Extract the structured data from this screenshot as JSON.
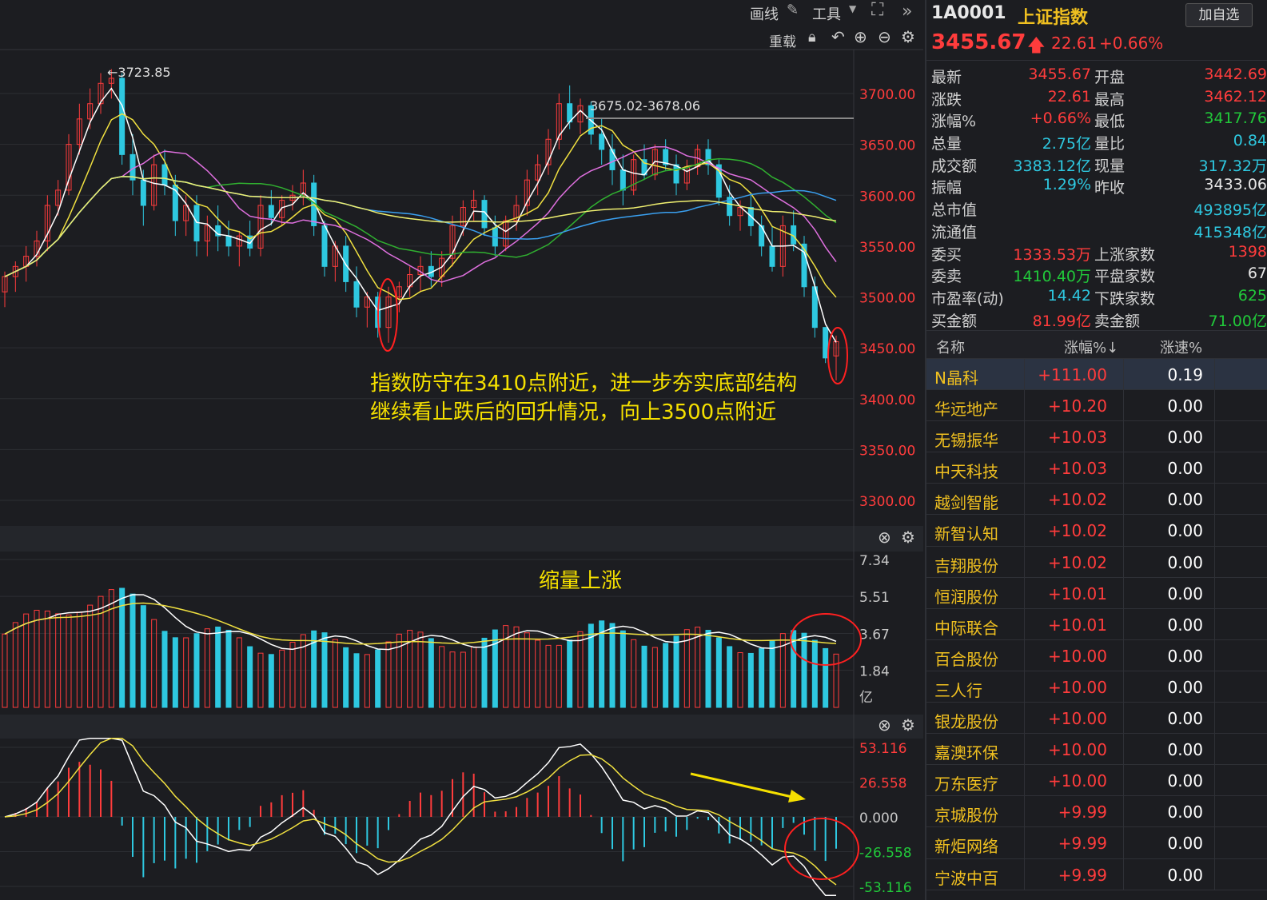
{
  "toolbar": {
    "draw": "画线",
    "tools": "工具",
    "restore": "重载"
  },
  "header": {
    "code": "1A0001",
    "name": "上证指数",
    "add_button": "加自选",
    "price": "3455.67",
    "change": "22.61",
    "change_pct": "+0.66%"
  },
  "quote": [
    {
      "l1": "最新",
      "v1": "3455.67",
      "c1": "#ff3c3c",
      "l2": "开盘",
      "v2": "3442.69",
      "c2": "#ff3c3c"
    },
    {
      "l1": "涨跌",
      "v1": "22.61",
      "c1": "#ff3c3c",
      "l2": "最高",
      "v2": "3462.12",
      "c2": "#ff3c3c"
    },
    {
      "l1": "涨幅%",
      "v1": "+0.66%",
      "c1": "#ff3c3c",
      "l2": "最低",
      "v2": "3417.76",
      "c2": "#21c93a"
    },
    {
      "l1": "总量",
      "v1": "2.75亿",
      "c1": "#2ec8e0",
      "l2": "量比",
      "v2": "0.84",
      "c2": "#2ec8e0"
    },
    {
      "l1": "成交额",
      "v1": "3383.12亿",
      "c1": "#2ec8e0",
      "l2": "现量",
      "v2": "317.32万",
      "c2": "#2ec8e0"
    },
    {
      "l1": "振幅",
      "v1": "1.29%",
      "c1": "#2ec8e0",
      "l2": "昨收",
      "v2": "3433.06",
      "c2": "#e8e8e8"
    },
    {
      "l1": "总市值",
      "v1": "",
      "c1": "#2ec8e0",
      "l2": "",
      "v2": "493895亿",
      "c2": "#2ec8e0"
    },
    {
      "l1": "流通值",
      "v1": "",
      "c1": "#2ec8e0",
      "l2": "",
      "v2": "415348亿",
      "c2": "#2ec8e0"
    },
    {
      "l1": "委买",
      "v1": "1333.53万",
      "c1": "#ff3c3c",
      "l2": "上涨家数",
      "v2": "1398",
      "c2": "#ff3c3c"
    },
    {
      "l1": "委卖",
      "v1": "1410.40万",
      "c1": "#21c93a",
      "l2": "平盘家数",
      "v2": "67",
      "c2": "#e8e8e8"
    },
    {
      "l1": "市盈率(动)",
      "v1": "14.42",
      "c1": "#2ec8e0",
      "l2": "下跌家数",
      "v2": "625",
      "c2": "#21c93a"
    },
    {
      "l1": "买金额",
      "v1": "81.99亿",
      "c1": "#ff3c3c",
      "l2": "卖金额",
      "v2": "71.00亿",
      "c2": "#21c93a"
    }
  ],
  "table": {
    "headers": [
      "名称",
      "涨幅%↓",
      "涨速%"
    ],
    "rows": [
      {
        "name": "N晶科",
        "pct": "+111.00",
        "speed": "0.19",
        "selected": true
      },
      {
        "name": "华远地产",
        "pct": "+10.20",
        "speed": "0.00"
      },
      {
        "name": "无锡振华",
        "pct": "+10.03",
        "speed": "0.00"
      },
      {
        "name": "中天科技",
        "pct": "+10.03",
        "speed": "0.00"
      },
      {
        "name": "越剑智能",
        "pct": "+10.02",
        "speed": "0.00"
      },
      {
        "name": "新智认知",
        "pct": "+10.02",
        "speed": "0.00"
      },
      {
        "name": "吉翔股份",
        "pct": "+10.02",
        "speed": "0.00"
      },
      {
        "name": "恒润股份",
        "pct": "+10.01",
        "speed": "0.00"
      },
      {
        "name": "中际联合",
        "pct": "+10.01",
        "speed": "0.00"
      },
      {
        "name": "百合股份",
        "pct": "+10.00",
        "speed": "0.00"
      },
      {
        "name": "三人行",
        "pct": "+10.00",
        "speed": "0.00"
      },
      {
        "name": "银龙股份",
        "pct": "+10.00",
        "speed": "0.00"
      },
      {
        "name": "嘉澳环保",
        "pct": "+10.00",
        "speed": "0.00"
      },
      {
        "name": "万东医疗",
        "pct": "+10.00",
        "speed": "0.00"
      },
      {
        "name": "京城股份",
        "pct": "+9.99",
        "speed": "0.00"
      },
      {
        "name": "新炬网络",
        "pct": "+9.99",
        "speed": "0.00"
      },
      {
        "name": "宁波中百",
        "pct": "+9.99",
        "speed": "0.00"
      }
    ]
  },
  "annotations": {
    "high": "←3723.85",
    "range": "3675.02-3678.06",
    "note_line1": "指数防守在3410点附近，进一步夯实底部结构",
    "note_line2": "继续看止跌后的回升情况，向上3500点附近",
    "volume_note": "缩量上涨"
  },
  "colors": {
    "up": "#ff3c3c",
    "down": "#2ec8e0",
    "note": "#f5e000"
  },
  "chart_data": [
    {
      "type": "candlestick",
      "title": "",
      "yticks": [
        "3700.00",
        "3650.00",
        "3600.00",
        "3550.00",
        "3500.00",
        "3450.00",
        "3400.00",
        "3350.00",
        "3300.00"
      ],
      "ylim": [
        3285,
        3740
      ],
      "candles": [
        [
          3505,
          3525,
          3490,
          3520
        ],
        [
          3520,
          3535,
          3505,
          3530
        ],
        [
          3530,
          3550,
          3515,
          3540
        ],
        [
          3540,
          3565,
          3530,
          3555
        ],
        [
          3555,
          3600,
          3545,
          3590
        ],
        [
          3590,
          3615,
          3580,
          3605
        ],
        [
          3605,
          3660,
          3600,
          3650
        ],
        [
          3650,
          3690,
          3640,
          3675
        ],
        [
          3675,
          3705,
          3665,
          3690
        ],
        [
          3690,
          3720,
          3680,
          3710
        ],
        [
          3710,
          3724,
          3695,
          3715
        ],
        [
          3715,
          3720,
          3630,
          3640
        ],
        [
          3640,
          3660,
          3600,
          3615
        ],
        [
          3615,
          3625,
          3570,
          3590
        ],
        [
          3590,
          3640,
          3585,
          3630
        ],
        [
          3630,
          3645,
          3600,
          3610
        ],
        [
          3610,
          3620,
          3560,
          3575
        ],
        [
          3575,
          3600,
          3560,
          3590
        ],
        [
          3590,
          3600,
          3540,
          3555
        ],
        [
          3555,
          3580,
          3540,
          3570
        ],
        [
          3570,
          3590,
          3545,
          3560
        ],
        [
          3560,
          3575,
          3540,
          3550
        ],
        [
          3550,
          3565,
          3530,
          3560
        ],
        [
          3560,
          3575,
          3540,
          3548
        ],
        [
          3548,
          3600,
          3540,
          3590
        ],
        [
          3590,
          3605,
          3570,
          3578
        ],
        [
          3578,
          3600,
          3570,
          3595
        ],
        [
          3595,
          3610,
          3585,
          3600
        ],
        [
          3600,
          3625,
          3590,
          3612
        ],
        [
          3612,
          3620,
          3560,
          3570
        ],
        [
          3570,
          3575,
          3520,
          3530
        ],
        [
          3530,
          3555,
          3515,
          3550
        ],
        [
          3550,
          3560,
          3505,
          3515
        ],
        [
          3515,
          3530,
          3480,
          3490
        ],
        [
          3490,
          3505,
          3470,
          3500
        ],
        [
          3500,
          3505,
          3460,
          3470
        ],
        [
          3470,
          3510,
          3455,
          3500
        ],
        [
          3500,
          3515,
          3485,
          3510
        ],
        [
          3510,
          3530,
          3500,
          3522
        ],
        [
          3522,
          3540,
          3505,
          3530
        ],
        [
          3530,
          3545,
          3510,
          3520
        ],
        [
          3520,
          3545,
          3510,
          3538
        ],
        [
          3538,
          3580,
          3530,
          3570
        ],
        [
          3570,
          3595,
          3560,
          3588
        ],
        [
          3588,
          3605,
          3575,
          3595
        ],
        [
          3595,
          3600,
          3560,
          3568
        ],
        [
          3568,
          3580,
          3540,
          3550
        ],
        [
          3550,
          3580,
          3545,
          3575
        ],
        [
          3575,
          3600,
          3565,
          3590
        ],
        [
          3590,
          3625,
          3580,
          3615
        ],
        [
          3615,
          3640,
          3600,
          3630
        ],
        [
          3630,
          3665,
          3620,
          3655
        ],
        [
          3655,
          3700,
          3645,
          3690
        ],
        [
          3690,
          3708,
          3665,
          3672
        ],
        [
          3672,
          3695,
          3660,
          3688
        ],
        [
          3688,
          3692,
          3650,
          3660
        ],
        [
          3660,
          3675,
          3630,
          3645
        ],
        [
          3645,
          3660,
          3610,
          3625
        ],
        [
          3625,
          3640,
          3590,
          3605
        ],
        [
          3605,
          3640,
          3600,
          3635
        ],
        [
          3635,
          3650,
          3615,
          3620
        ],
        [
          3620,
          3650,
          3615,
          3645
        ],
        [
          3645,
          3655,
          3625,
          3630
        ],
        [
          3630,
          3640,
          3600,
          3612
        ],
        [
          3612,
          3635,
          3605,
          3628
        ],
        [
          3628,
          3650,
          3620,
          3645
        ],
        [
          3645,
          3655,
          3620,
          3630
        ],
        [
          3630,
          3635,
          3590,
          3598
        ],
        [
          3598,
          3610,
          3570,
          3580
        ],
        [
          3580,
          3595,
          3565,
          3588
        ],
        [
          3588,
          3600,
          3560,
          3570
        ],
        [
          3570,
          3580,
          3540,
          3550
        ],
        [
          3550,
          3570,
          3525,
          3530
        ],
        [
          3530,
          3580,
          3520,
          3570
        ],
        [
          3570,
          3585,
          3545,
          3552
        ],
        [
          3552,
          3560,
          3500,
          3510
        ],
        [
          3510,
          3520,
          3460,
          3470
        ],
        [
          3470,
          3462,
          3435,
          3440
        ],
        [
          3442,
          3462,
          3418,
          3456
        ]
      ]
    },
    {
      "type": "bar",
      "title": "",
      "yticks": [
        "7.34",
        "5.51",
        "3.67",
        "1.84"
      ],
      "unit": "亿",
      "ylim": [
        0,
        7.34
      ]
    },
    {
      "type": "bar",
      "title": "",
      "yticks": [
        "53.116",
        "26.558",
        "0.000",
        "-26.558",
        "-53.116"
      ],
      "ylim": [
        -53.116,
        53.116
      ]
    }
  ]
}
